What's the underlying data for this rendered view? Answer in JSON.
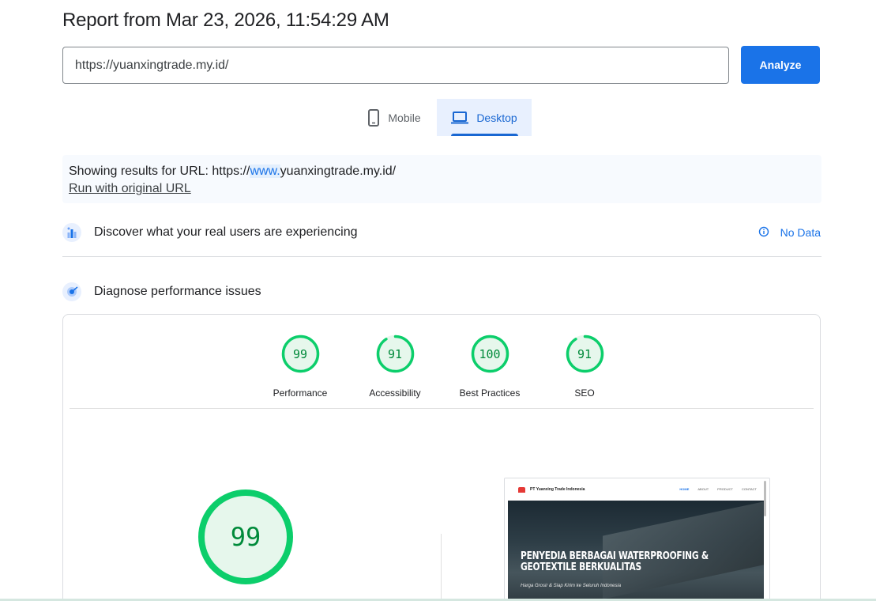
{
  "report": {
    "title": "Report from Mar 23, 2026, 11:54:29 AM"
  },
  "search": {
    "url_value": "https://yuanxingtrade.my.id/",
    "analyze_label": "Analyze"
  },
  "device_tabs": {
    "mobile_label": "Mobile",
    "desktop_label": "Desktop",
    "selected": "Desktop"
  },
  "notice": {
    "prefix": "Showing results for URL: https://",
    "highlight": "www.",
    "suffix": "yuanxingtrade.my.id/",
    "original_link": "Run with original URL"
  },
  "field_data": {
    "label": "Discover what your real users are experiencing",
    "status": "No Data"
  },
  "lab_data": {
    "label": "Diagnose performance issues"
  },
  "scores": [
    {
      "label": "Performance",
      "value": "99"
    },
    {
      "label": "Accessibility",
      "value": "91"
    },
    {
      "label": "Best Practices",
      "value": "100"
    },
    {
      "label": "SEO",
      "value": "91"
    }
  ],
  "main_score": {
    "value": "99"
  },
  "preview": {
    "brand": "PT Yuanxing Trade Indonesia",
    "menu": [
      "HOME",
      "ABOUT",
      "PRODUCT",
      "CONTACT"
    ],
    "headline": "PENYEDIA BERBAGAI WATERPROOFING & GEOTEXTILE BERKUALITAS",
    "subtitle": "Harga Grosir & Siap Kirim ke Seluruh Indonesia"
  },
  "colors": {
    "accent": "#1a73e8",
    "pass": "#0cce6b",
    "pass_text": "#008a3a",
    "pass_fill": "#e6f7ec"
  },
  "icons": {
    "mobile": "phone-icon",
    "desktop": "laptop-icon",
    "field": "users-chart-icon",
    "lab": "lab-diagnose-icon",
    "info": "info-icon"
  }
}
